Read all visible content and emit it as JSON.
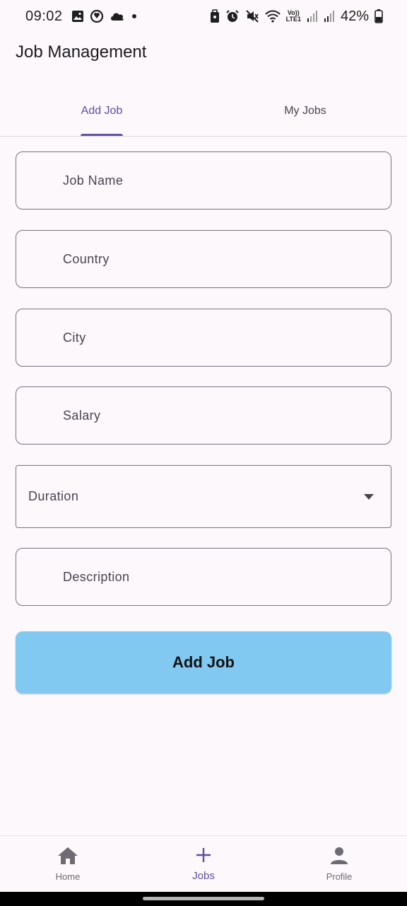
{
  "status_bar": {
    "time": "09:02",
    "battery_percent": "42%",
    "volte_top": "Vo))",
    "volte_bottom": "LTE1",
    "icons": [
      "image-icon",
      "sync-icon",
      "cloud-icon",
      "dot-icon",
      "lock-icon",
      "alarm-icon",
      "mute-icon",
      "wifi-icon",
      "signal-icon",
      "signal-icon",
      "battery-icon"
    ]
  },
  "app": {
    "title": "Job Management"
  },
  "tabs": [
    {
      "label": "Add Job",
      "active": true
    },
    {
      "label": "My Jobs",
      "active": false
    }
  ],
  "form": {
    "job_name": {
      "placeholder": "Job Name",
      "value": ""
    },
    "country": {
      "placeholder": "Country",
      "value": ""
    },
    "city": {
      "placeholder": "City",
      "value": ""
    },
    "salary": {
      "placeholder": "Salary",
      "value": ""
    },
    "duration": {
      "label": "Duration",
      "options": []
    },
    "description": {
      "placeholder": "Description",
      "value": ""
    },
    "submit_label": "Add Job"
  },
  "bottom_nav": [
    {
      "label": "Home",
      "icon": "home-icon",
      "active": false
    },
    {
      "label": "Jobs",
      "icon": "plus-icon",
      "active": true
    },
    {
      "label": "Profile",
      "icon": "person-icon",
      "active": false
    }
  ],
  "colors": {
    "accent": "#6750a4",
    "button": "#81c9f1",
    "background": "#fdf8fb",
    "outline": "#79747e"
  }
}
